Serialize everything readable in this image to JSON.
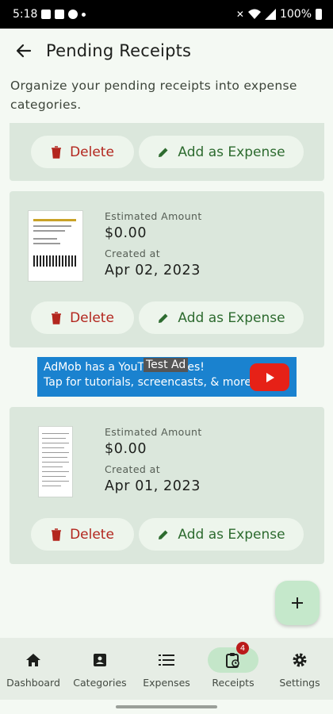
{
  "status_bar": {
    "time": "5:18",
    "battery": "100%"
  },
  "header": {
    "title": "Pending Receipts"
  },
  "subtitle": "Organize your pending receipts into expense categories.",
  "actions": {
    "delete_label": "Delete",
    "add_label": "Add as Expense"
  },
  "receipts": [
    {
      "estimated_label": "Estimated Amount",
      "amount": "$0.00",
      "created_label": "Created at",
      "date": "Apr 02, 2023"
    },
    {
      "estimated_label": "Estimated Amount",
      "amount": "$0.00",
      "created_label": "Created at",
      "date": "Apr 01, 2023"
    }
  ],
  "ad": {
    "line1": "AdMob has a YouTube series!",
    "line2": "Tap for tutorials, screencasts, & more.",
    "badge": "Test Ad"
  },
  "nav": {
    "items": [
      {
        "label": "Dashboard",
        "icon": "home-icon"
      },
      {
        "label": "Categories",
        "icon": "categories-icon"
      },
      {
        "label": "Expenses",
        "icon": "list-icon"
      },
      {
        "label": "Receipts",
        "icon": "receipt-icon",
        "badge": "4",
        "active": true
      },
      {
        "label": "Settings",
        "icon": "gear-icon"
      }
    ]
  },
  "colors": {
    "delete": "#b3261e",
    "add": "#2d6b2f",
    "card": "#dbe7dc",
    "active_nav": "#c4e6c9"
  }
}
